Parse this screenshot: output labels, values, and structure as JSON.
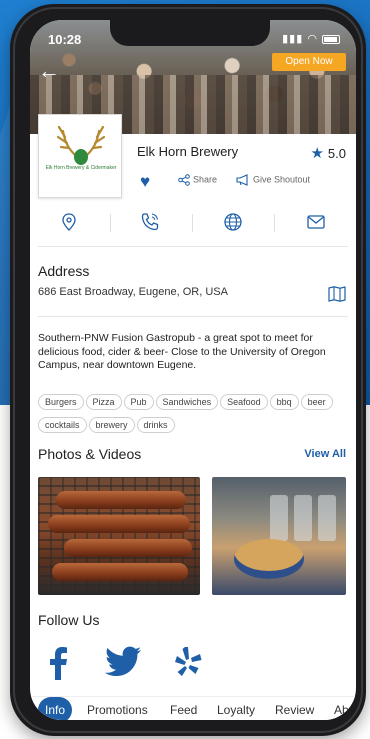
{
  "status_bar": {
    "time": "10:28"
  },
  "header": {
    "open_badge": "Open Now"
  },
  "business": {
    "name": "Elk Horn Brewery",
    "rating": "5.0",
    "logo_caption": "Elk Horn Brewery & Cidermaker",
    "share_label": "Share",
    "shoutout_label": "Give Shoutout",
    "address_title": "Address",
    "address": "686 East Broadway, Eugene, OR, USA",
    "description": "Southern-PNW Fusion Gastropub - a great spot to meet for delicious food, cider & beer- Close to the University of Oregon Campus, near downtown Eugene.",
    "tags": [
      "Burgers",
      "Pizza",
      "Pub",
      "Sandwiches",
      "Seafood",
      "bbq",
      "beer",
      "cocktails",
      "brewery",
      "drinks"
    ]
  },
  "photos": {
    "title": "Photos & Videos",
    "view_all": "View All"
  },
  "follow": {
    "title": "Follow Us"
  },
  "tabs": [
    "Info",
    "Promotions",
    "Feed",
    "Loyalty",
    "Review",
    "Ab"
  ],
  "colors": {
    "accent": "#1f5fa8",
    "badge": "#f5a623",
    "backdrop": "#1668b5"
  },
  "icons": {
    "contact": [
      "location-pin-icon",
      "phone-icon",
      "globe-icon",
      "mail-icon"
    ],
    "social": [
      "facebook-icon",
      "twitter-icon",
      "yelp-icon"
    ]
  }
}
